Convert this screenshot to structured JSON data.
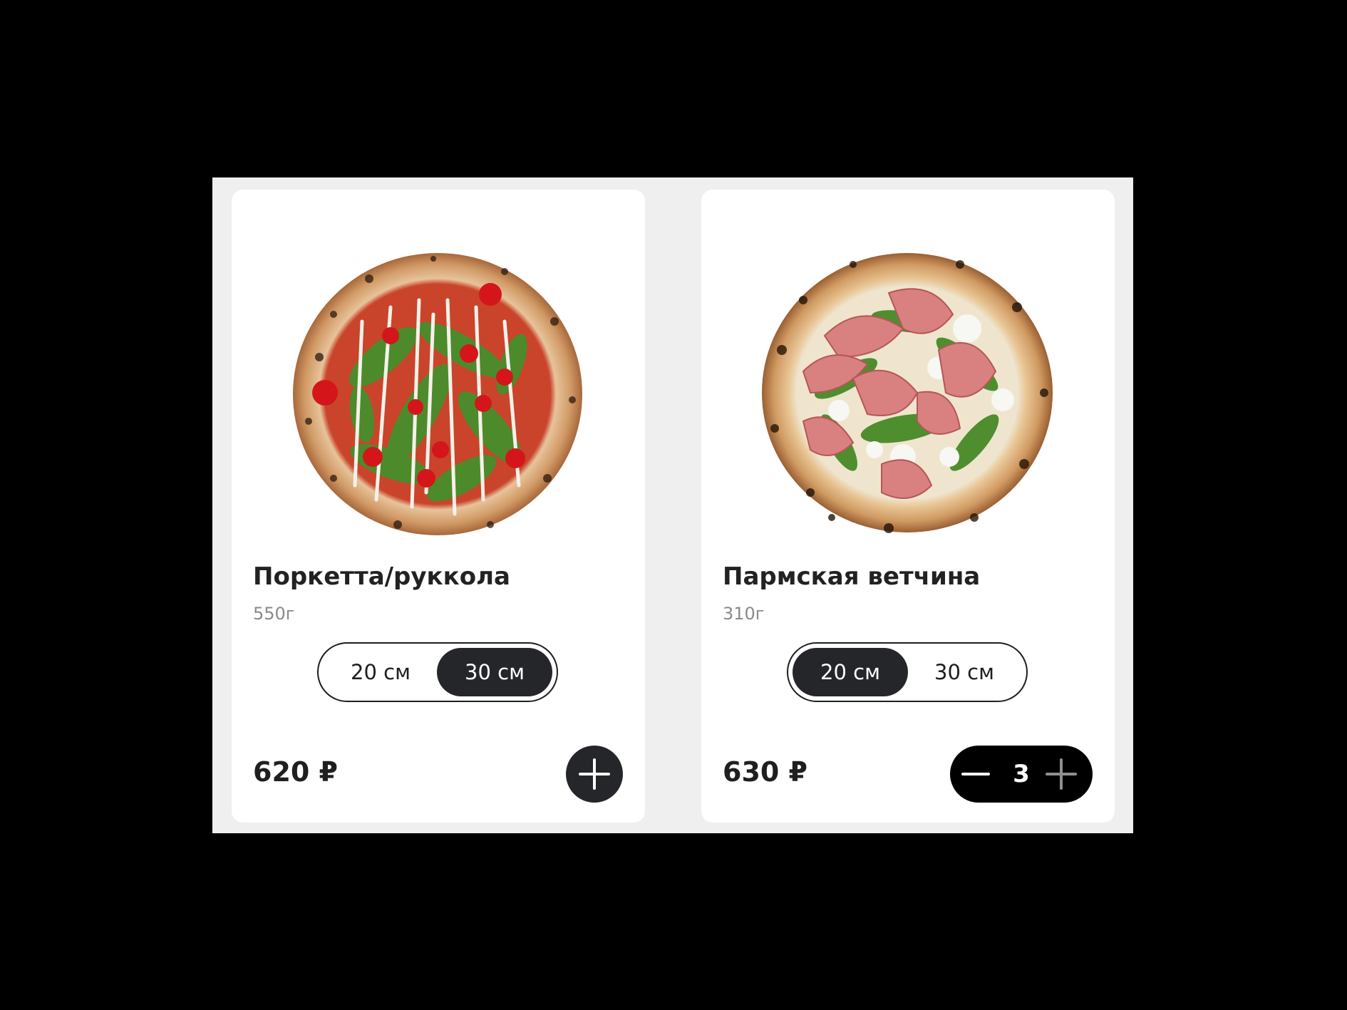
{
  "products": [
    {
      "title": "Поркетта/руккола",
      "weight": "550г",
      "sizes": [
        "20 см",
        "30 см"
      ],
      "selected_size": "30 см",
      "price": "620 ₽",
      "image_icon": "pizza-arugula-image"
    },
    {
      "title": "Пармская ветчина",
      "weight": "310г",
      "sizes": [
        "20 см",
        "30 см"
      ],
      "selected_size": "20 см",
      "price": "630 ₽",
      "quantity": "3",
      "image_icon": "pizza-parma-image"
    }
  ],
  "colors": {
    "page_background": "#000000",
    "panel_background": "#efefef",
    "card_background": "#ffffff",
    "accent_dark": "#25262a",
    "muted_text": "#8a8a8a"
  }
}
